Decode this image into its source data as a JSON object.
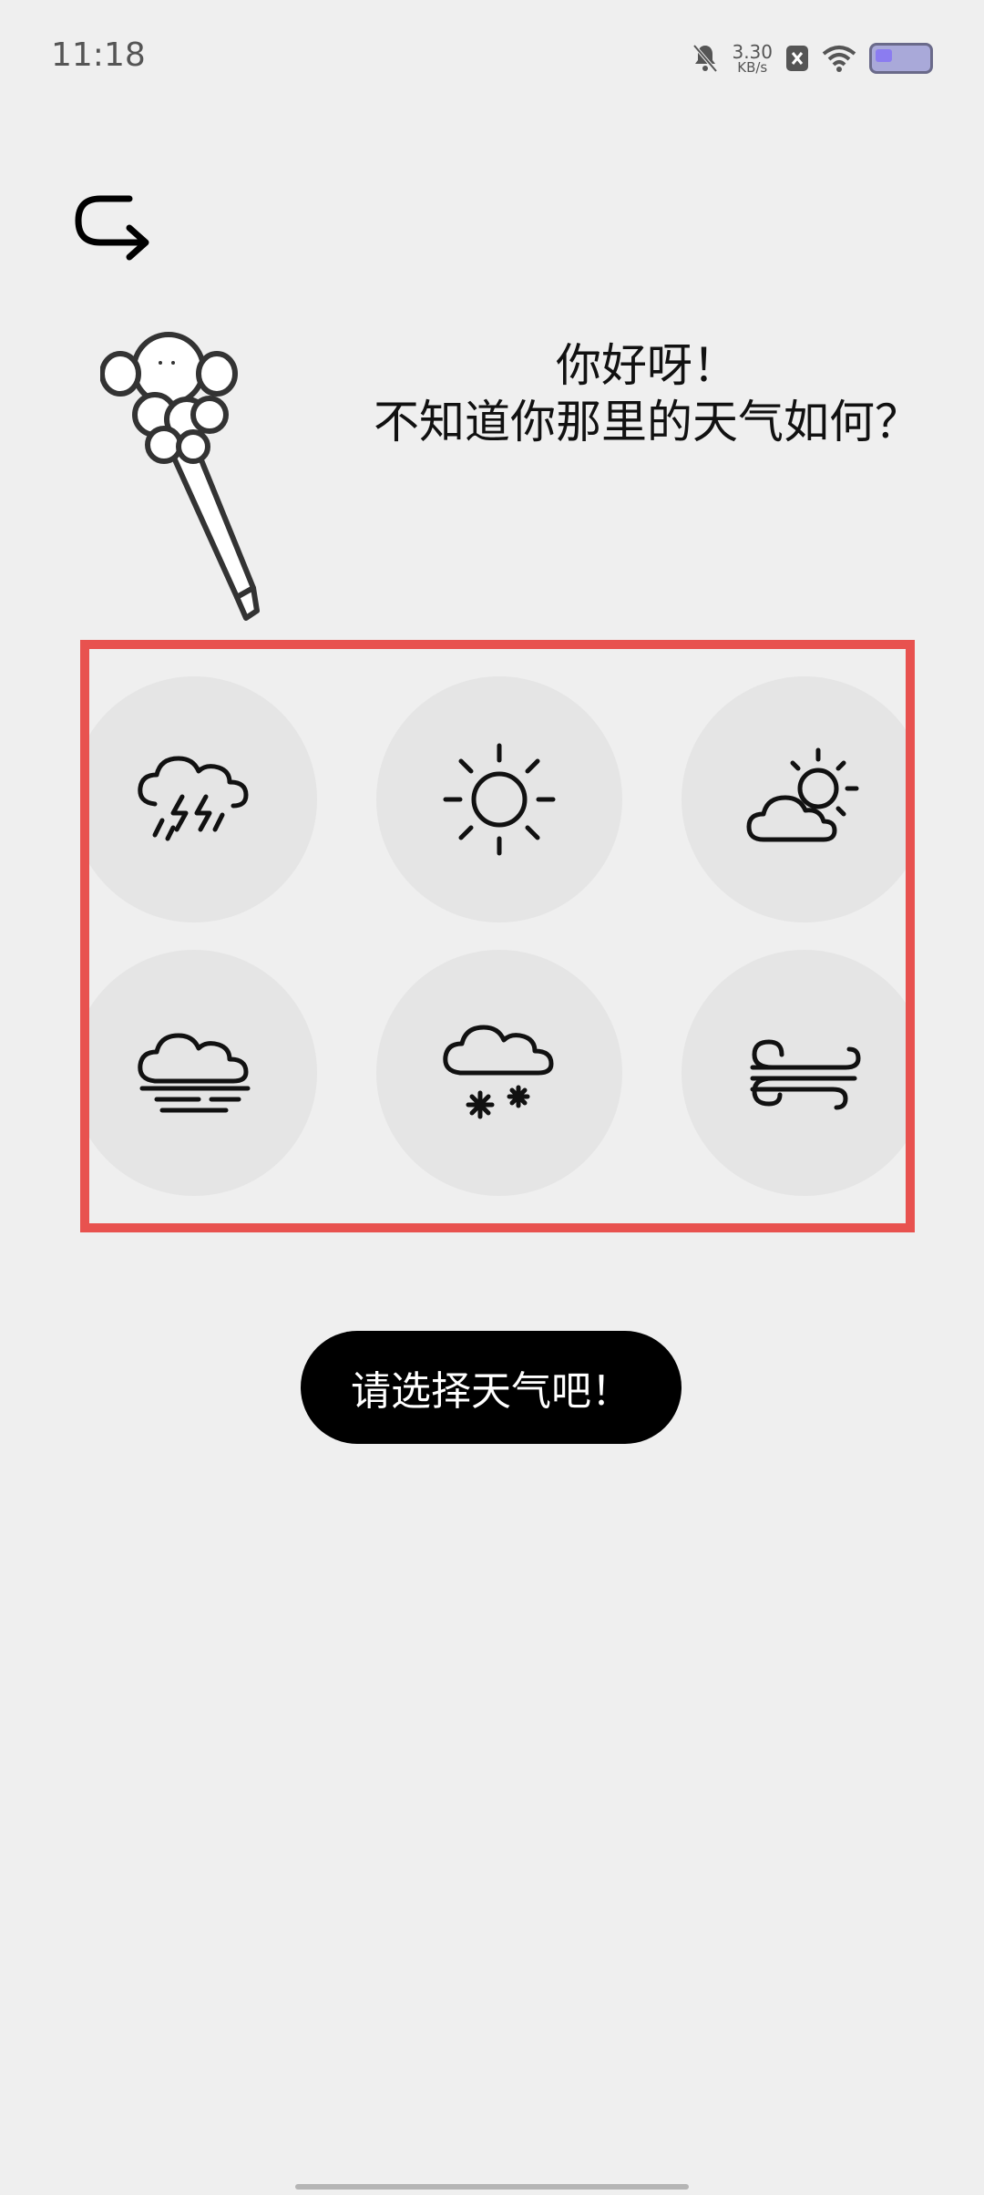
{
  "status_bar": {
    "time": "11:18",
    "net_speed_value": "3.30",
    "net_speed_unit": "KB/s",
    "icons": [
      "bell-off-icon",
      "close-notification-icon",
      "wifi-icon",
      "battery-icon"
    ]
  },
  "greeting": {
    "line1": "你好呀！",
    "line2": "不知道你那里的天气如何？"
  },
  "weather_options": [
    {
      "name": "thunderstorm",
      "icon": "thunderstorm-icon"
    },
    {
      "name": "sunny",
      "icon": "sun-icon"
    },
    {
      "name": "partly-cloudy",
      "icon": "partly-cloudy-icon"
    },
    {
      "name": "fog",
      "icon": "fog-icon"
    },
    {
      "name": "snow",
      "icon": "snow-icon"
    },
    {
      "name": "windy",
      "icon": "wind-icon"
    }
  ],
  "confirm_button": {
    "label": "请选择天气吧！"
  },
  "colors": {
    "background": "#efefef",
    "highlight_border": "#e8524f",
    "circle": "#e5e5e5",
    "button": "#000000"
  }
}
